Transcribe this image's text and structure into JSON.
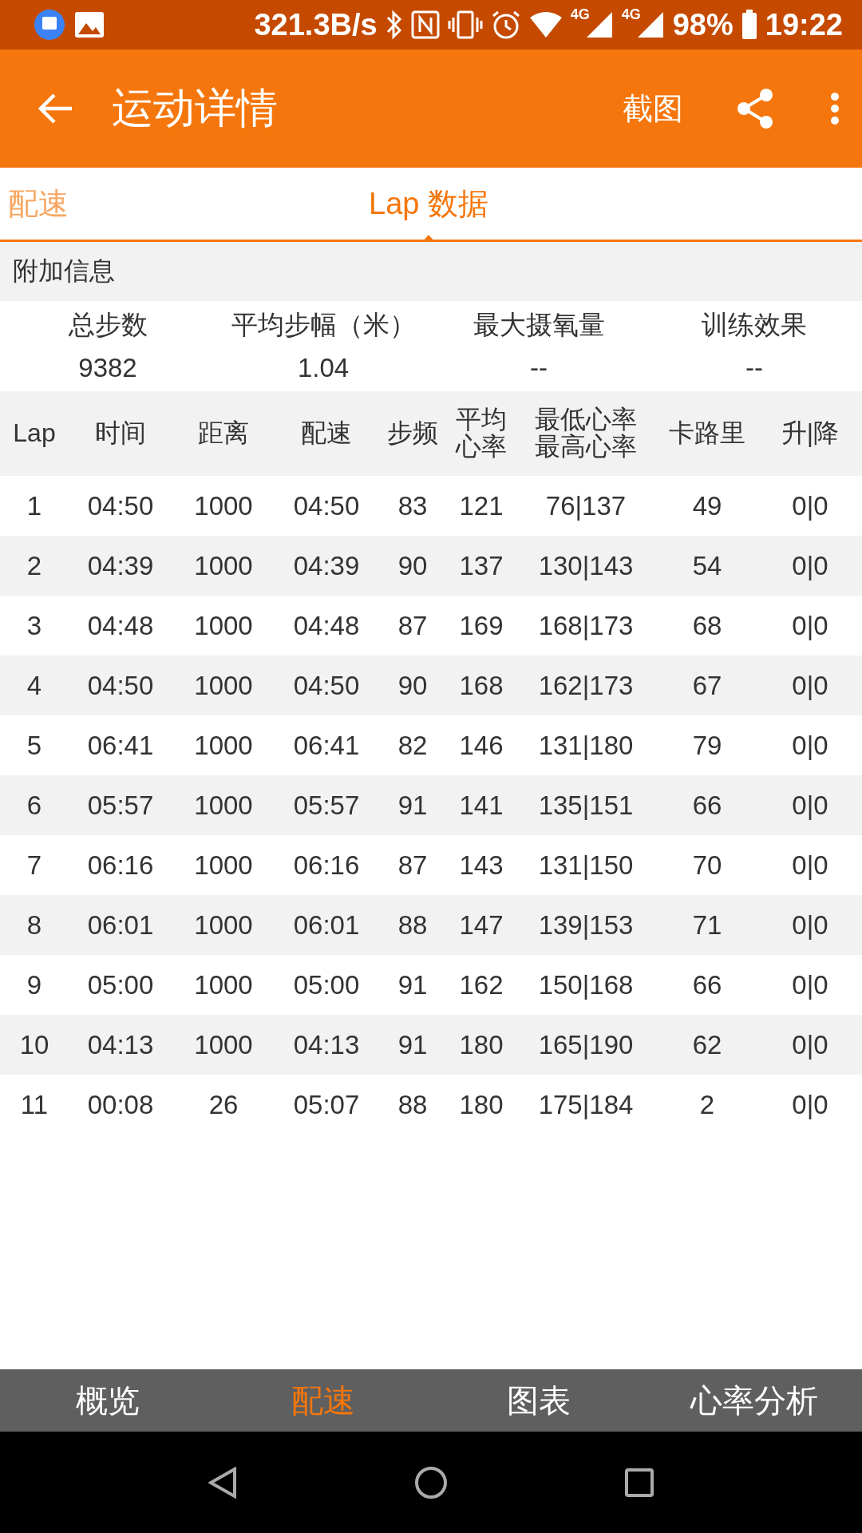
{
  "status_bar": {
    "speed": "321.3B/s",
    "sim1": "4G",
    "sim2": "4G",
    "battery": "98%",
    "time": "19:22"
  },
  "app_bar": {
    "title": "运动详情",
    "action": "截图"
  },
  "tabs": [
    {
      "label": "配速",
      "selected": false
    },
    {
      "label": "Lap 数据",
      "selected": true
    }
  ],
  "section_title": "附加信息",
  "summary": [
    {
      "label": "总步数",
      "value": "9382"
    },
    {
      "label": "平均步幅（米）",
      "value": "1.04"
    },
    {
      "label": "最大摄氧量",
      "value": "--"
    },
    {
      "label": "训练效果",
      "value": "--"
    }
  ],
  "table": {
    "columns": [
      "Lap",
      "时间",
      "距离",
      "配速",
      "步频",
      "平均心率",
      "最低心率最高心率",
      "卡路里",
      "升|降"
    ],
    "rows": [
      [
        "1",
        "04:50",
        "1000",
        "04:50",
        "83",
        "121",
        "76|137",
        "49",
        "0|0"
      ],
      [
        "2",
        "04:39",
        "1000",
        "04:39",
        "90",
        "137",
        "130|143",
        "54",
        "0|0"
      ],
      [
        "3",
        "04:48",
        "1000",
        "04:48",
        "87",
        "169",
        "168|173",
        "68",
        "0|0"
      ],
      [
        "4",
        "04:50",
        "1000",
        "04:50",
        "90",
        "168",
        "162|173",
        "67",
        "0|0"
      ],
      [
        "5",
        "06:41",
        "1000",
        "06:41",
        "82",
        "146",
        "131|180",
        "79",
        "0|0"
      ],
      [
        "6",
        "05:57",
        "1000",
        "05:57",
        "91",
        "141",
        "135|151",
        "66",
        "0|0"
      ],
      [
        "7",
        "06:16",
        "1000",
        "06:16",
        "87",
        "143",
        "131|150",
        "70",
        "0|0"
      ],
      [
        "8",
        "06:01",
        "1000",
        "06:01",
        "88",
        "147",
        "139|153",
        "71",
        "0|0"
      ],
      [
        "9",
        "05:00",
        "1000",
        "05:00",
        "91",
        "162",
        "150|168",
        "66",
        "0|0"
      ],
      [
        "10",
        "04:13",
        "1000",
        "04:13",
        "91",
        "180",
        "165|190",
        "62",
        "0|0"
      ],
      [
        "11",
        "00:08",
        "26",
        "05:07",
        "88",
        "180",
        "175|184",
        "2",
        "0|0"
      ]
    ]
  },
  "bottom_nav": [
    {
      "label": "概览",
      "selected": false
    },
    {
      "label": "配速",
      "selected": true
    },
    {
      "label": "图表",
      "selected": false
    },
    {
      "label": "心率分析",
      "selected": false
    }
  ]
}
